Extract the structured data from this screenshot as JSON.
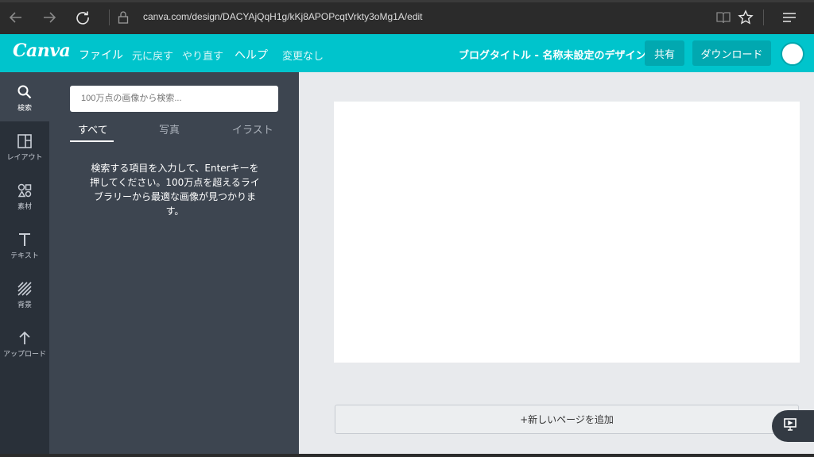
{
  "browser": {
    "url": "canva.com/design/DACYAjQqH1g/kKj8APOPcqtVrkty3oMg1A/edit",
    "icons": [
      "back-arrow-icon",
      "forward-arrow-icon",
      "refresh-icon",
      "lock-icon",
      "reading-view-icon",
      "favorite-star-icon",
      "hub-menu-icon"
    ]
  },
  "header": {
    "logo": "Canva",
    "menu": {
      "file": "ファイル",
      "undo": "元に戻す",
      "redo": "やり直す",
      "help": "ヘルプ",
      "status": "変更なし"
    },
    "design_title": "ブログタイトル - 名称未設定のデザイン",
    "share_label": "共有",
    "download_label": "ダウンロード",
    "accent_color": "#00c4cc"
  },
  "sidebar": {
    "items": [
      {
        "label": "検索",
        "icon": "search-icon"
      },
      {
        "label": "レイアウト",
        "icon": "layout-icon"
      },
      {
        "label": "素材",
        "icon": "elements-icon"
      },
      {
        "label": "テキスト",
        "icon": "text-icon"
      },
      {
        "label": "背景",
        "icon": "background-icon"
      },
      {
        "label": "アップロード",
        "icon": "upload-icon"
      }
    ]
  },
  "search_panel": {
    "placeholder": "100万点の画像から検索...",
    "tabs": [
      "すべて",
      "写真",
      "イラスト"
    ],
    "help_text": "検索する項目を入力して、Enterキーを押してください。100万点を超えるライブラリーから最適な画像が見つかります。"
  },
  "canvas": {
    "add_page_label": "+新しいページを追加"
  }
}
